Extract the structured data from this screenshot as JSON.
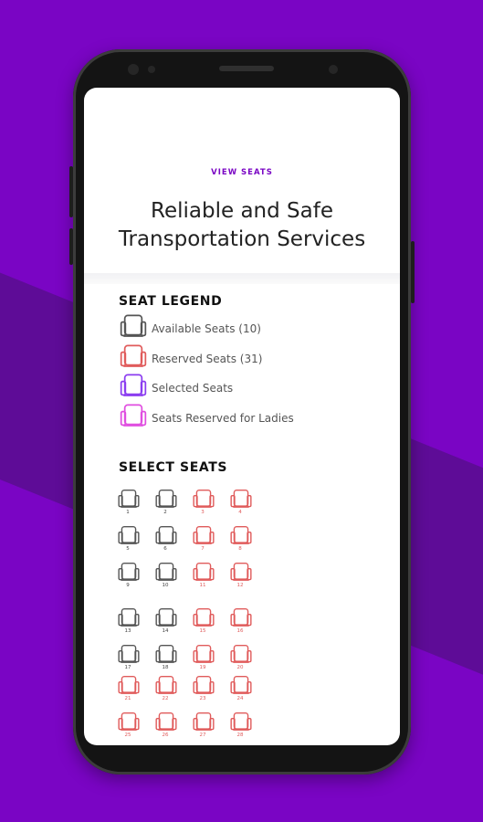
{
  "header": {
    "link": "VIEW SEATS",
    "title": "Reliable and Safe\nTransportation Services"
  },
  "legend": {
    "title": "SEAT LEGEND",
    "items": [
      {
        "label": "Available Seats (10)",
        "color": "#555555"
      },
      {
        "label": "Reserved Seats (31)",
        "color": "#e05b5b"
      },
      {
        "label": "Selected Seats",
        "color": "#8b3df0"
      },
      {
        "label": "Seats Reserved for Ladies",
        "color": "#e04ee0"
      }
    ]
  },
  "select": {
    "title": "SELECT SEATS",
    "seats": [
      {
        "n": "1",
        "s": "a"
      },
      {
        "n": "2",
        "s": "a"
      },
      {
        "n": "3",
        "s": "r"
      },
      {
        "n": "4",
        "s": "r"
      },
      {
        "n": "5",
        "s": "a"
      },
      {
        "n": "6",
        "s": "a"
      },
      {
        "n": "7",
        "s": "r"
      },
      {
        "n": "8",
        "s": "r"
      },
      {
        "n": "9",
        "s": "a"
      },
      {
        "n": "10",
        "s": "a"
      },
      {
        "n": "11",
        "s": "r"
      },
      {
        "n": "12",
        "s": "r"
      },
      {
        "n": "13",
        "s": "a"
      },
      {
        "n": "14",
        "s": "a"
      },
      {
        "n": "15",
        "s": "r"
      },
      {
        "n": "16",
        "s": "r"
      },
      {
        "n": "17",
        "s": "a"
      },
      {
        "n": "18",
        "s": "a"
      },
      {
        "n": "19",
        "s": "r"
      },
      {
        "n": "20",
        "s": "r"
      },
      {
        "n": "21",
        "s": "r"
      },
      {
        "n": "22",
        "s": "r"
      },
      {
        "n": "23",
        "s": "r"
      },
      {
        "n": "24",
        "s": "r"
      },
      {
        "n": "25",
        "s": "r"
      },
      {
        "n": "26",
        "s": "r"
      },
      {
        "n": "27",
        "s": "r"
      },
      {
        "n": "28",
        "s": "r"
      }
    ]
  },
  "colors": {
    "available": "#555555",
    "reserved": "#e05b5b",
    "selected": "#8b3df0",
    "ladies": "#e04ee0",
    "background": "#7a05c4"
  }
}
